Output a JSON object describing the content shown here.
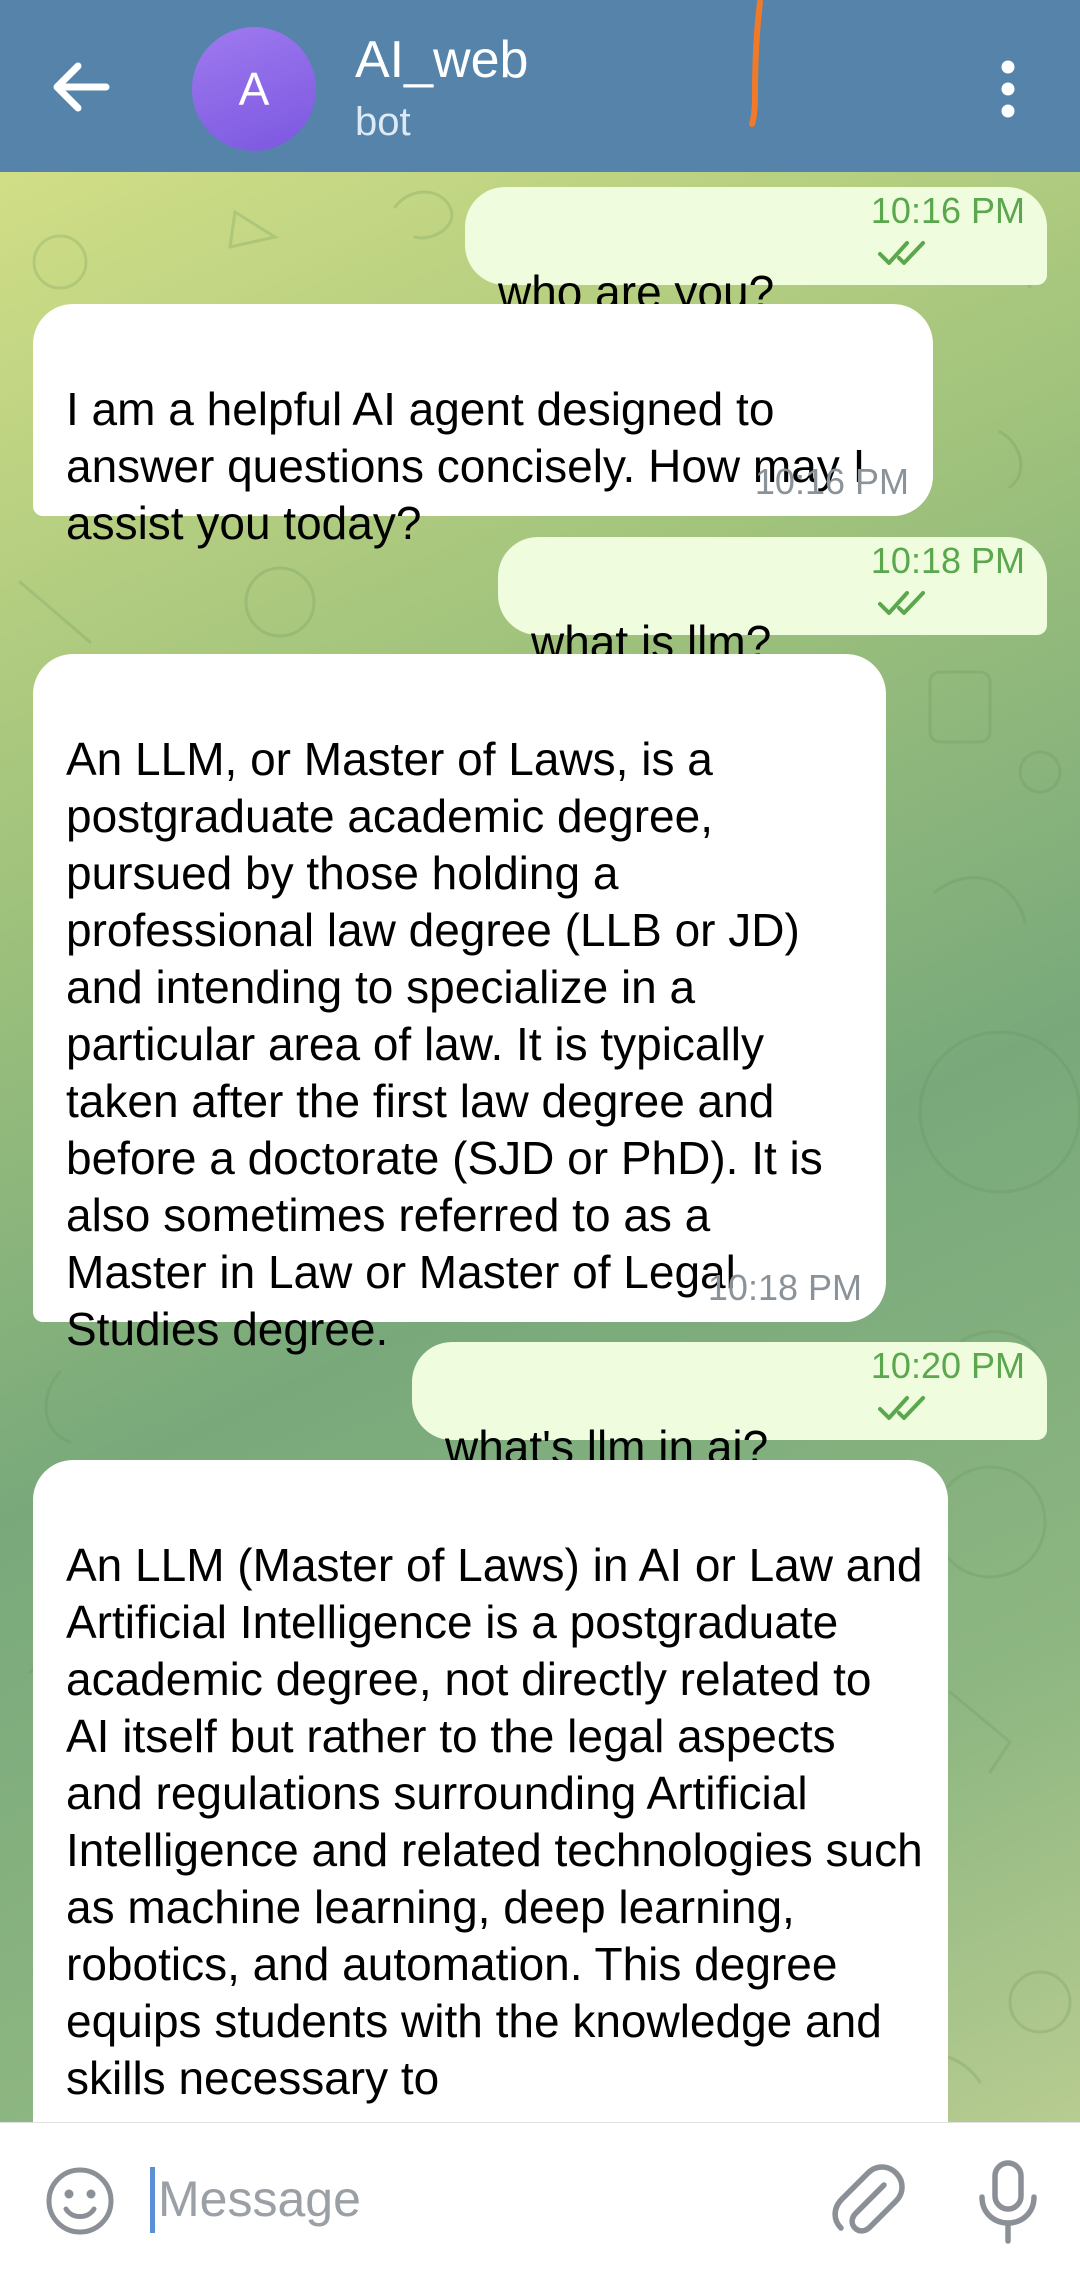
{
  "header": {
    "avatar_letter": "A",
    "title": "AI_web",
    "subtitle": "bot"
  },
  "messages": [
    {
      "direction": "outgoing",
      "text": "who are you?",
      "time": "10:16 PM",
      "read": true
    },
    {
      "direction": "incoming",
      "text": "I am a helpful AI agent designed to answer questions concisely. How may I assist you today?",
      "time": "10:16 PM"
    },
    {
      "direction": "outgoing",
      "text": "what is llm?",
      "time": "10:18 PM",
      "read": true
    },
    {
      "direction": "incoming",
      "text": "An LLM, or Master of Laws, is a postgraduate academic degree, pursued by those holding a professional law degree (LLB or JD) and intending to specialize in a particular area of law. It is typically taken after the first law degree and before a doctorate (SJD or PhD). It is also sometimes referred to as a Master in Law or Master of Legal Studies degree.",
      "time": "10:18 PM"
    },
    {
      "direction": "outgoing",
      "text": "what's llm in ai?",
      "time": "10:20 PM",
      "read": true
    },
    {
      "direction": "incoming",
      "text": "An LLM (Master of Laws) in AI or Law and Artificial Intelligence is a postgraduate academic degree, not directly related to AI itself but rather to the legal aspects and regulations surrounding Artificial Intelligence and related technologies such as machine learning, deep learning, robotics, and automation. This degree equips students with the knowledge and skills necessary to"
    }
  ],
  "composer": {
    "placeholder": "Message"
  },
  "icons": {
    "back": "arrow-left-icon",
    "menu": "more-vertical-icon",
    "emoji": "smiley-icon",
    "attach": "paperclip-icon",
    "mic": "microphone-icon",
    "read_receipt": "double-check-icon"
  },
  "colors": {
    "header": "#5583a9",
    "avatar": "#8b67e8",
    "outgoing_bubble": "#effcdd",
    "incoming_bubble": "#ffffff",
    "outgoing_meta": "#5ba74e",
    "incoming_meta": "#8b939a",
    "annotation_mark": "#f07a2a"
  }
}
